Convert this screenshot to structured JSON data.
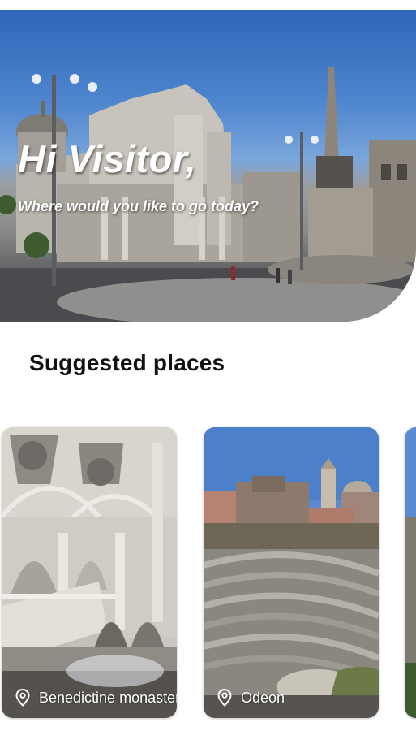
{
  "hero": {
    "title": "Hi Visitor,",
    "subtitle": "Where would you like to go today?"
  },
  "suggested": {
    "section_title": "Suggested places",
    "places": [
      {
        "name": "Benedictine monastery",
        "icon": "location-pin-icon"
      },
      {
        "name": "Odeon",
        "icon": "location-pin-icon"
      },
      {
        "name": "",
        "icon": "location-pin-icon"
      }
    ]
  },
  "colors": {
    "sky": "#3a72c0",
    "text_primary": "#111111",
    "label_text": "#ffffff"
  }
}
